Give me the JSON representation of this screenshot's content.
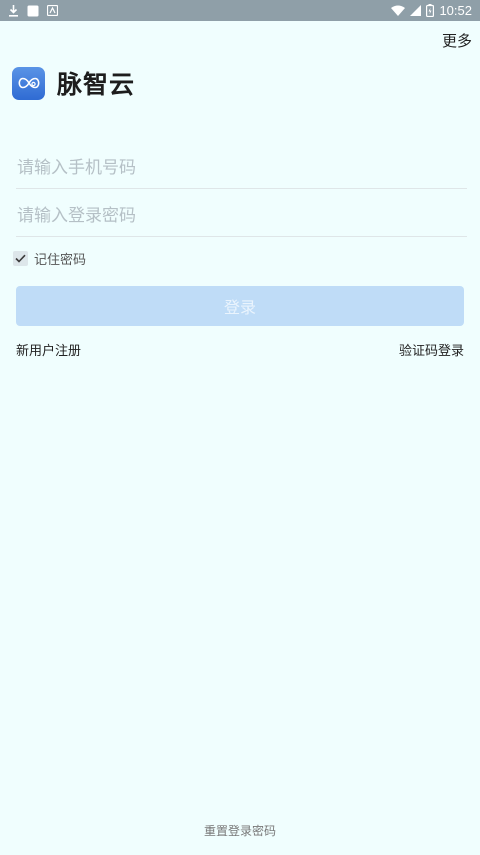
{
  "status_bar": {
    "time": "10:52",
    "left_icons": [
      "download-icon",
      "notification-square-icon",
      "app-notification-icon"
    ],
    "right_icons": [
      "wifi-icon",
      "cell-signal-icon",
      "battery-icon"
    ]
  },
  "header": {
    "more_label": "更多"
  },
  "brand": {
    "name": "脉智云",
    "logo_icon": "infinity-logo-icon",
    "logo_color": "#3c7bdc"
  },
  "form": {
    "phone_placeholder": "请输入手机号码",
    "phone_value": "",
    "password_placeholder": "请输入登录密码",
    "password_value": "",
    "remember_label": "记住密码",
    "remember_checked": true,
    "login_label": "登录",
    "login_button_color": "#bfdcf7"
  },
  "links": {
    "register": "新用户注册",
    "sms_login": "验证码登录",
    "reset_password": "重置登录密码"
  },
  "colors": {
    "background": "#f0fefe",
    "status_bar": "#8f9fa8"
  }
}
